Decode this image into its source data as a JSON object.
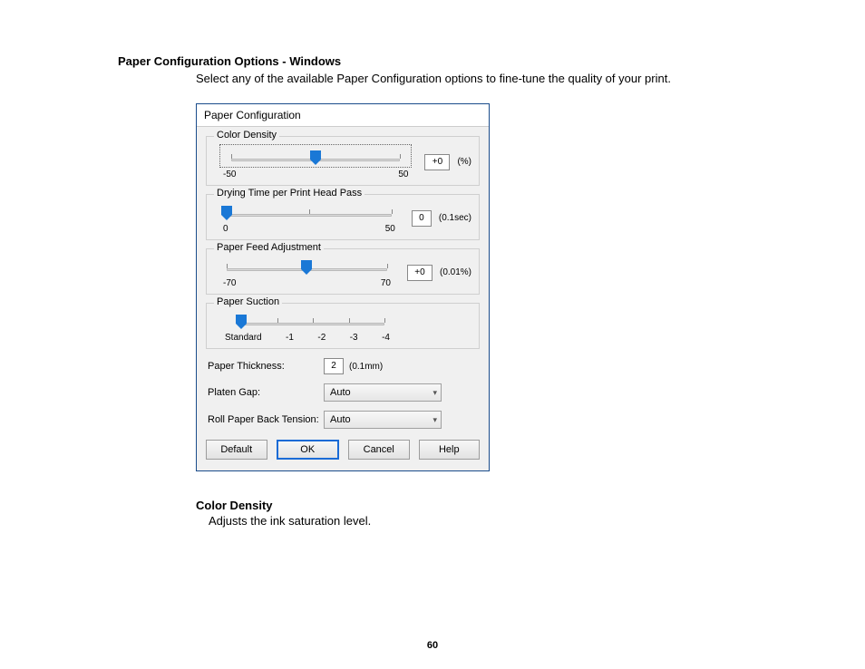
{
  "doc": {
    "heading": "Paper Configuration Options - Windows",
    "intro": "Select any of the available Paper Configuration options to fine-tune the quality of your print.",
    "term": "Color Density",
    "definition": "Adjusts the ink saturation level.",
    "page_number": "60"
  },
  "dialog": {
    "title": "Paper Configuration",
    "color_density": {
      "legend": "Color Density",
      "min_label": "-50",
      "max_label": "50",
      "value": "+0",
      "unit": "(%)"
    },
    "drying_time": {
      "legend": "Drying Time per Print Head Pass",
      "min_label": "0",
      "max_label": "50",
      "value": "0",
      "unit": "(0.1sec)"
    },
    "feed_adjust": {
      "legend": "Paper Feed Adjustment",
      "min_label": "-70",
      "max_label": "70",
      "value": "+0",
      "unit": "(0.01%)"
    },
    "suction": {
      "legend": "Paper Suction",
      "labels": [
        "Standard",
        "-1",
        "-2",
        "-3",
        "-4"
      ]
    },
    "thickness": {
      "label": "Paper Thickness:",
      "value": "2",
      "unit": "(0.1mm)"
    },
    "platen_gap": {
      "label": "Platen Gap:",
      "value": "Auto"
    },
    "back_tension": {
      "label": "Roll Paper Back Tension:",
      "value": "Auto"
    },
    "buttons": {
      "default": "Default",
      "ok": "OK",
      "cancel": "Cancel",
      "help": "Help"
    }
  }
}
